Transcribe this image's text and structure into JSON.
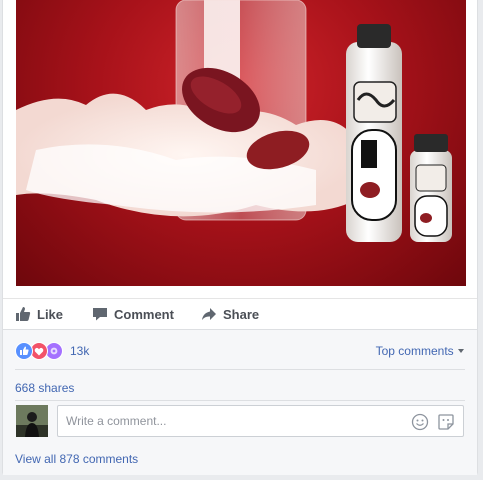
{
  "post": {
    "actions": {
      "like": "Like",
      "comment": "Comment",
      "share": "Share"
    }
  },
  "footer": {
    "reactions_count": "13k",
    "top_comments": "Top comments",
    "shares": "668 shares",
    "comment_placeholder": "Write a comment...",
    "view_all": "View all 878 comments"
  },
  "colors": {
    "link": "#4267b2",
    "like": "#5890ff",
    "love": "#f25268",
    "wow": "#a470ff"
  },
  "icons": [
    "thumbs-up-icon",
    "speech-bubble-icon",
    "share-arrow-icon",
    "like-reaction-icon",
    "love-reaction-icon",
    "wow-reaction-icon",
    "emoji-icon",
    "sticker-icon",
    "caret-down-icon"
  ]
}
